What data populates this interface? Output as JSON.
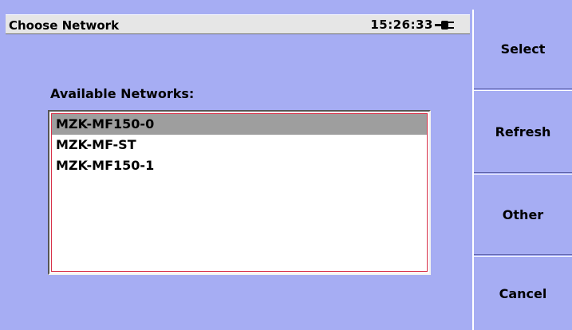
{
  "title_bar": {
    "title": "Choose Network",
    "time": "15:26:33",
    "power_icon": "ac-power-plug-icon"
  },
  "main": {
    "networks_label": "Available Networks:",
    "networks": [
      {
        "name": "MZK-MF150-0",
        "selected": true
      },
      {
        "name": "MZK-MF-ST",
        "selected": false
      },
      {
        "name": "MZK-MF150-1",
        "selected": false
      }
    ]
  },
  "softkeys": {
    "select": "Select",
    "refresh": "Refresh",
    "other": "Other",
    "cancel": "Cancel"
  },
  "colors": {
    "background": "#a6adf3",
    "selection": "#9e9e9e",
    "list_border": "#d8324a"
  }
}
